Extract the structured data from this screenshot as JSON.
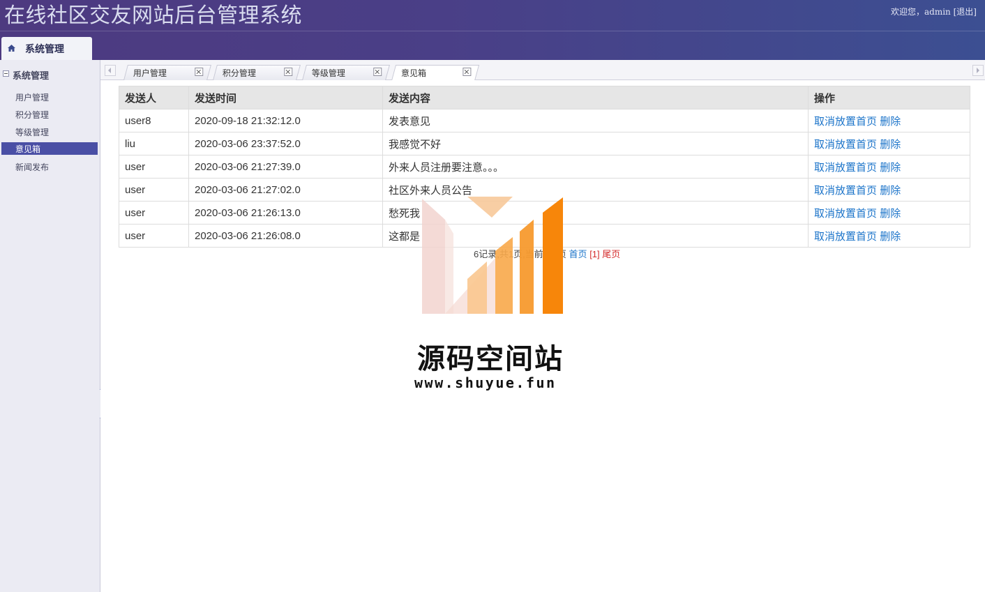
{
  "header": {
    "title": "在线社区交友网站后台管理系统",
    "welcome_text": "欢迎您，admin",
    "logout_label": "[退出]",
    "system_tab": "系统管理"
  },
  "sidebar": {
    "group_title": "系统管理",
    "items": [
      {
        "label": "用户管理"
      },
      {
        "label": "积分管理"
      },
      {
        "label": "等级管理"
      },
      {
        "label": "意见箱"
      },
      {
        "label": "新闻发布"
      }
    ],
    "active_index": 3
  },
  "tabs": [
    {
      "label": "用户管理"
    },
    {
      "label": "积分管理"
    },
    {
      "label": "等级管理"
    },
    {
      "label": "意见箱"
    }
  ],
  "table": {
    "headers": [
      "发送人",
      "发送时间",
      "发送内容",
      "操作"
    ],
    "rows": [
      {
        "sender": "user8",
        "time": "2020-09-18 21:32:12.0",
        "content": "发表意见",
        "action1": "取消放置首页",
        "action2": "删除"
      },
      {
        "sender": "liu",
        "time": "2020-03-06 23:37:52.0",
        "content": "我感觉不好",
        "action1": "取消放置首页",
        "action2": "删除"
      },
      {
        "sender": "user",
        "time": "2020-03-06 21:27:39.0",
        "content": "外来人员注册要注意。。。",
        "action1": "取消放置首页",
        "action2": "删除"
      },
      {
        "sender": "user",
        "time": "2020-03-06 21:27:02.0",
        "content": "社区外来人员公告",
        "action1": "取消放置首页",
        "action2": "删除"
      },
      {
        "sender": "user",
        "time": "2020-03-06 21:26:13.0",
        "content": "愁死我",
        "action1": "取消放置首页",
        "action2": "删除"
      },
      {
        "sender": "user",
        "time": "2020-03-06 21:26:08.0",
        "content": "这都是",
        "action1": "取消放置首页",
        "action2": "删除"
      }
    ]
  },
  "pager": {
    "summary": "6记录,共1页,当前第1页",
    "first": "首页",
    "current": "[1]",
    "last": "尾页"
  },
  "watermark": {
    "title": "源码空间站",
    "url": "www.shuyue.fun"
  },
  "colors": {
    "header_start": "#4d3a80",
    "header_end": "#3c4f92",
    "active_menu": "#4a4fa5",
    "link": "#1a73c9",
    "pager_red": "#d42b2b",
    "watermark_orange": "#f7860a"
  }
}
